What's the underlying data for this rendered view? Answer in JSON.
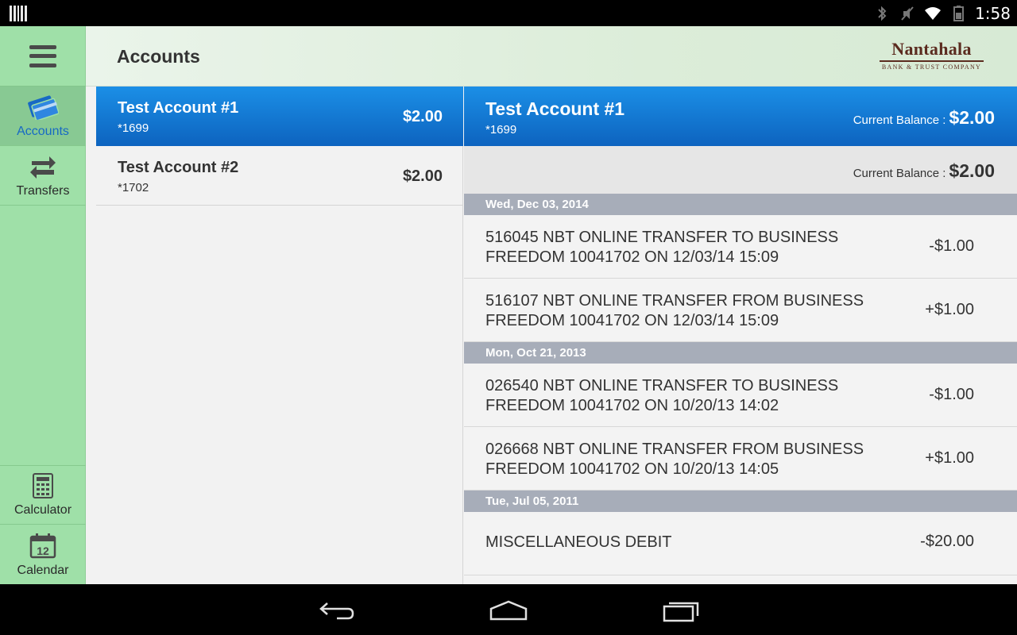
{
  "status_bar": {
    "time": "1:58",
    "icons": [
      "bluetooth-icon",
      "muted-icon",
      "wifi-icon",
      "battery-icon"
    ]
  },
  "header": {
    "title": "Accounts",
    "logo_name": "Nantahala",
    "logo_sub": "BANK & TRUST COMPANY"
  },
  "sidebar": {
    "menu_icon": "hamburger-icon",
    "items": [
      {
        "label": "Accounts",
        "icon": "card-icon"
      },
      {
        "label": "Transfers",
        "icon": "transfer-arrows-icon"
      },
      {
        "label": "Calculator",
        "icon": "calculator-icon"
      },
      {
        "label": "Calendar",
        "icon": "calendar-icon",
        "badge": "12"
      }
    ]
  },
  "accounts": [
    {
      "name": "Test Account #1",
      "number": "*1699",
      "balance": "$2.00"
    },
    {
      "name": "Test Account #2",
      "number": "*1702",
      "balance": "$2.00"
    }
  ],
  "detail": {
    "name": "Test Account #1",
    "number": "*1699",
    "balance_label": "Current Balance :",
    "balance": "$2.00",
    "summary_label": "Current Balance :",
    "summary_balance": "$2.00",
    "groups": [
      {
        "date": "Wed, Dec 03, 2014",
        "transactions": [
          {
            "line1": "516045 NBT ONLINE TRANSFER TO BUSINESS",
            "line2": "FREEDOM 10041702 ON 12/03/14 15:09",
            "amount": "-$1.00"
          },
          {
            "line1": "516107 NBT ONLINE TRANSFER FROM BUSINESS",
            "line2": "FREEDOM 10041702 ON 12/03/14 15:09",
            "amount": "+$1.00"
          }
        ]
      },
      {
        "date": "Mon, Oct 21, 2013",
        "transactions": [
          {
            "line1": "026540 NBT ONLINE TRANSFER TO BUSINESS",
            "line2": "FREEDOM 10041702 ON 10/20/13 14:02",
            "amount": "-$1.00"
          },
          {
            "line1": "026668 NBT ONLINE TRANSFER FROM BUSINESS",
            "line2": "FREEDOM 10041702 ON 10/20/13 14:05",
            "amount": "+$1.00"
          }
        ]
      },
      {
        "date": "Tue, Jul 05, 2011",
        "transactions": [
          {
            "line1": "MISCELLANEOUS DEBIT",
            "amount": "-$20.00"
          }
        ]
      }
    ]
  },
  "system_nav": {
    "icons": [
      "back-icon",
      "home-icon",
      "recents-icon"
    ]
  },
  "colors": {
    "sidebar_bg": "#9fe0a8",
    "selected_blue": "#1b8fe6",
    "date_header": "#a7adb9",
    "logo_brown": "#5b2b1f"
  }
}
